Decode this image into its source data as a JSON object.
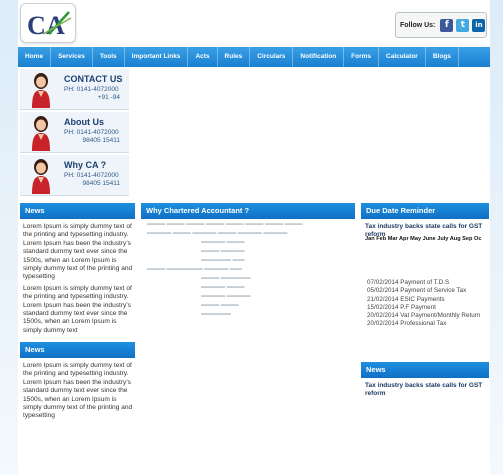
{
  "logo": {
    "text": "CA"
  },
  "follow": {
    "label": "Follow Us:",
    "icons": [
      {
        "name": "facebook-icon",
        "glyph": "f",
        "color": "#3b5998"
      },
      {
        "name": "twitter-icon",
        "glyph": "t",
        "color": "#41abe1"
      },
      {
        "name": "linkedin-icon",
        "glyph": "in",
        "color": "#0a66a8"
      }
    ]
  },
  "nav": [
    "Home",
    "Services",
    "Tools",
    "Important Links",
    "Acts",
    "Rules",
    "Circulars",
    "Notification",
    "Forms",
    "Calculator",
    "Blogs"
  ],
  "contacts": [
    {
      "title": "CONTACT US",
      "phone": "PH: 0141-4072000",
      "phone2": "+91 -94"
    },
    {
      "title": "About Us",
      "phone": "PH: 0141-4072000",
      "phone2": "98405 15411"
    },
    {
      "title": "Why CA ?",
      "phone": "PH: 0141-4072000",
      "phone2": "98405 15411"
    }
  ],
  "news1": {
    "heading": "News",
    "paragraphs": [
      "Lorem Ipsum is simply dummy text of the printing and typesetting industry. Lorem Ipsum has been the industry's standard dummy text ever since the 1500s, when an Lorem Ipsum is simply dummy text of the printing and typesetting",
      "Lorem Ipsum is simply dummy text of the printing and typesetting industry. Lorem Ipsum has been the industry's standard dummy text ever since the 1500s, when an Lorem Ipsum is simply dummy text"
    ]
  },
  "news2": {
    "heading": "News",
    "paragraphs": [
      "Lorem Ipsum is simply dummy text of the printing and typesetting industry. Lorem Ipsum has been the industry's standard dummy text ever since the 1500s, when an Lorem Ipsum is simply dummy text of the printing and typesetting"
    ]
  },
  "why": {
    "heading": "Why Chartered Accountant ?"
  },
  "due": {
    "heading": "Due Date Reminder",
    "headline": "Tax industry backs state calls for GST reform",
    "months": "Jan Feb Mar Apr May June July Aug Sep Oc",
    "items": [
      "07/02/2014 Payment of T.D.S",
      "05/02/2014 Payment of Service Tax",
      "21/02/2014 ESIC Payments",
      "15/02/2014 P.F Payment",
      "20/02/2014 Vat Payment/Monthly Return",
      "20/02/2014 Professional Tax"
    ]
  },
  "news3": {
    "heading": "News",
    "headline": "Tax industry backs state calls for GST reform"
  },
  "colors": {
    "nav": "#1a7fd0",
    "panel_head": "#1070c4",
    "title_blue": "#1d3f73"
  }
}
